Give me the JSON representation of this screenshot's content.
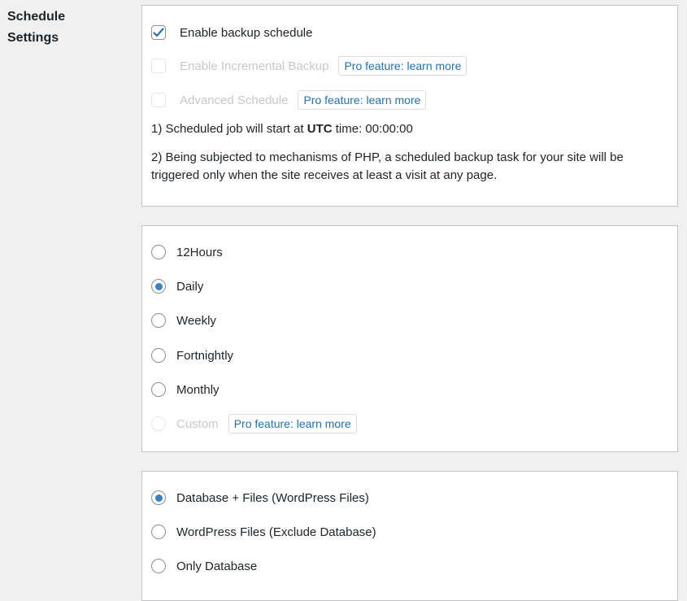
{
  "settings_label": "Schedule Settings",
  "panel1": {
    "enable_backup_schedule": {
      "label": "Enable backup schedule",
      "checked": true
    },
    "enable_incremental_backup": {
      "label": "Enable Incremental Backup",
      "pro": "Pro feature: learn more",
      "disabled": true
    },
    "advanced_schedule": {
      "label": "Advanced Schedule",
      "pro": "Pro feature: learn more",
      "disabled": true
    },
    "note1": {
      "prefix": "1) Scheduled job will start at ",
      "bold": "UTC",
      "suffix": " time: 00:00:00"
    },
    "note2": "2) Being subjected to mechanisms of PHP, a scheduled backup task for your site will be triggered only when the site receives at least a visit at any page."
  },
  "frequency": {
    "options": [
      {
        "label": "12Hours",
        "checked": false
      },
      {
        "label": "Daily",
        "checked": true
      },
      {
        "label": "Weekly",
        "checked": false
      },
      {
        "label": "Fortnightly",
        "checked": false
      },
      {
        "label": "Monthly",
        "checked": false
      },
      {
        "label": "Custom",
        "checked": false,
        "disabled": true,
        "pro": "Pro feature: learn more"
      }
    ]
  },
  "backup_type": {
    "options": [
      {
        "label": "Database + Files (WordPress Files)",
        "checked": true
      },
      {
        "label": "WordPress Files (Exclude Database)",
        "checked": false
      },
      {
        "label": "Only Database",
        "checked": false
      }
    ]
  },
  "colors": {
    "accent": "#2271b1",
    "radio_dot": "#3582c4",
    "check": "#2271b1"
  }
}
